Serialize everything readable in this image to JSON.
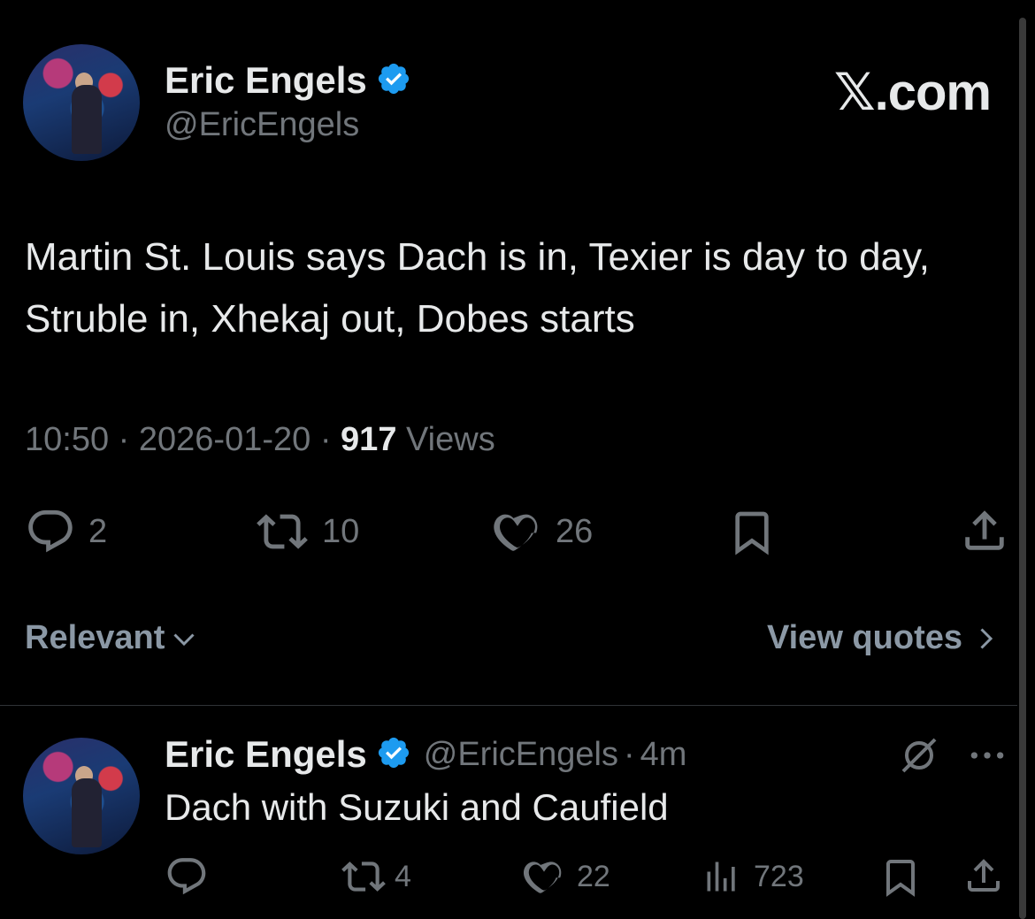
{
  "main_tweet": {
    "author_name": "Eric Engels",
    "author_handle": "@EricEngels",
    "brand": "𝕏.com",
    "text": "Martin St. Louis says Dach is in, Texier is day to day, Struble in, Xhekaj out, Dobes starts",
    "time": "10:50",
    "date": "2026-01-20",
    "sep": "·",
    "views_count": "917",
    "views_label": "Views",
    "replies": "2",
    "reposts": "10",
    "likes": "26"
  },
  "filters": {
    "sort_label": "Relevant",
    "quotes_label": "View quotes"
  },
  "reply": {
    "author_name": "Eric Engels",
    "author_handle": "@EricEngels",
    "sep": "·",
    "age": "4m",
    "text": "Dach with Suzuki and Caufield",
    "reposts": "4",
    "likes": "22",
    "views": "723"
  },
  "colors": {
    "background": "#000000",
    "text": "#e7e9ea",
    "muted": "#71767b",
    "verified": "#1d9bf0"
  },
  "icons": [
    "verified-badge-icon",
    "reply-icon",
    "repost-icon",
    "like-icon",
    "bookmark-icon",
    "share-icon",
    "chevron-down-icon",
    "chevron-right-icon",
    "grok-icon",
    "more-icon",
    "views-icon"
  ]
}
